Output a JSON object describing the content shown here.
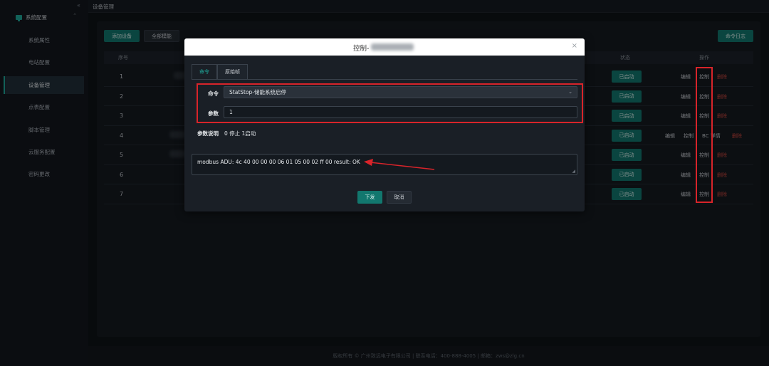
{
  "sidebar": {
    "collapse_icon": "«",
    "group": {
      "label": "系统配置",
      "icon": "monitor-icon",
      "caret": "⌃"
    },
    "items": [
      {
        "label": "系统属性",
        "active": false
      },
      {
        "label": "电站配置",
        "active": false
      },
      {
        "label": "设备管理",
        "active": true
      },
      {
        "label": "点表配置",
        "active": false
      },
      {
        "label": "脚本管理",
        "active": false
      },
      {
        "label": "云服务配置",
        "active": false
      },
      {
        "label": "密码更改",
        "active": false
      }
    ]
  },
  "header": {
    "breadcrumb": "设备管理"
  },
  "toolbar": {
    "add_label": "添加设备",
    "all_label": "全部模能",
    "log_label": "命令日志"
  },
  "table": {
    "headers": {
      "seq": "序号",
      "status": "状态",
      "ops": "操作"
    },
    "rows": [
      {
        "seq": "1",
        "status": "已启动",
        "ops": [
          "编辑",
          "控制",
          "删除"
        ]
      },
      {
        "seq": "2",
        "status": "已启动",
        "ops": [
          "编辑",
          "控制",
          "删除"
        ]
      },
      {
        "seq": "3",
        "status": "已启动",
        "ops": [
          "编辑",
          "控制",
          "删除"
        ]
      },
      {
        "seq": "4",
        "status": "已启动",
        "ops": [
          "编辑",
          "控制",
          "BC 详情",
          "删除"
        ]
      },
      {
        "seq": "5",
        "status": "已启动",
        "ops": [
          "编辑",
          "控制",
          "删除"
        ]
      },
      {
        "seq": "6",
        "status": "已启动",
        "ops": [
          "编辑",
          "控制",
          "删除"
        ]
      },
      {
        "seq": "7",
        "status": "已启动",
        "ops": [
          "编辑",
          "控制",
          "删除"
        ]
      }
    ]
  },
  "dialog": {
    "title": "控制-",
    "close": "×",
    "tabs": [
      {
        "label": "命令",
        "active": true
      },
      {
        "label": "原始帧",
        "active": false
      }
    ],
    "command_label": "命令",
    "command_value": "StatStop-储能系统启停",
    "param_label": "参数",
    "param_value": "1",
    "desc_label": "参数说明",
    "desc_value": "0 停止 1启动",
    "result_text": "modbus ADU: 4c 40 00 00 00 06 01 05 00 02 ff 00  result: OK",
    "submit_label": "下发",
    "cancel_label": "取消"
  },
  "footer": {
    "text": "版权所有 © 广州致远电子有限公司 | 联系电话：400-888-4005 | 邮箱：zws@zlg.cn"
  },
  "colors": {
    "accent": "#12776e",
    "danger": "#c9463d",
    "annotation": "#d8242a"
  }
}
